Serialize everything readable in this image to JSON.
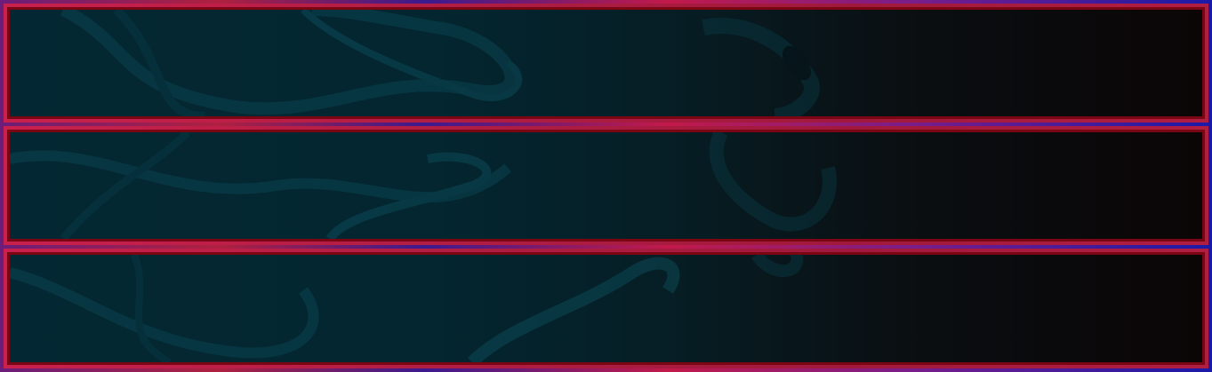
{
  "panels": [
    {
      "id": "panel-1"
    },
    {
      "id": "panel-2"
    },
    {
      "id": "panel-3"
    }
  ],
  "colors": {
    "border_outer": "#c9204d",
    "border_inner": "#7a0614",
    "panel_left": "#042833",
    "panel_right": "#0b0506",
    "frame_blue": "#1a1aa8"
  }
}
